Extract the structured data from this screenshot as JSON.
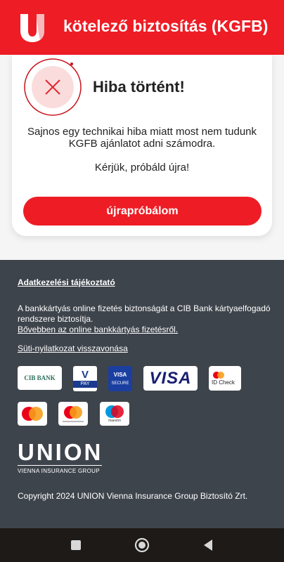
{
  "header": {
    "title": "kötelező biztosítás (KGFB)",
    "bg_color": "#ee1c25",
    "logo_icon": "union-u-logo"
  },
  "error": {
    "icon": "error-x-icon",
    "title": "Hiba történt!",
    "message": "Sajnos egy technikai hiba miatt most nem tudunk KGFB ajánlatot adni számodra.",
    "retry_prompt": "Kérjük, próbáld újra!",
    "retry_button": "újrapróbálom"
  },
  "footer": {
    "privacy_link": "Adatkezelési tájékoztató",
    "security_text": "A bankkártyás online fizetés biztonságát a CIB Bank kártyaelfogadó rendszere biztosítja.",
    "more_link": "Bővebben az online bankkártyás fizetésről.",
    "cookie_link": "Süti-nyilatkozat visszavonása",
    "payment_logos": {
      "cib": "CIB BANK",
      "vpay_top": "V",
      "vpay_bottom": "PAY",
      "visa_secure_top": "VISA",
      "visa_secure_bottom": "SECURE",
      "visa": "VISA",
      "id_check": "ID Check",
      "maestro_label": "maestro"
    },
    "brand": {
      "name": "UNION",
      "tagline": "VIENNA INSURANCE GROUP"
    },
    "copyright": "Copyright 2024 UNION Vienna Insurance Group Biztosító Zrt."
  },
  "navbar": {
    "recents_icon": "square-recents-icon",
    "home_icon": "circle-home-icon",
    "back_icon": "triangle-back-icon"
  }
}
